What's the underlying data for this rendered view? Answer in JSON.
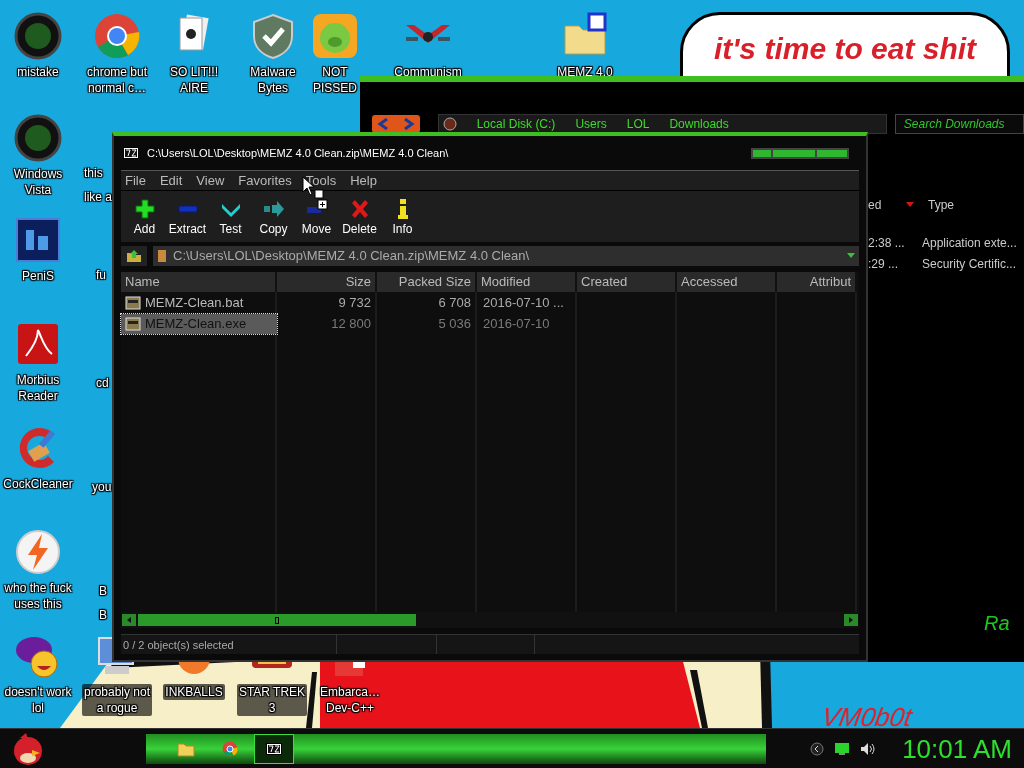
{
  "desktop": {
    "icons": [
      {
        "label": "mistake"
      },
      {
        "label": "chrome but\nnormal c…"
      },
      {
        "label": "SO LIT!!!\nAIRE"
      },
      {
        "label": "Malware\nBytes"
      },
      {
        "label": "NOT\nPISSED"
      },
      {
        "label": "Communism"
      },
      {
        "label": "MEMZ 4.0"
      },
      {
        "label": "Windows\nVista"
      },
      {
        "label": "PeniS"
      },
      {
        "label": "Morbius\nReader"
      },
      {
        "label": "CockCleaner"
      },
      {
        "label": "who the fuck\nuses this"
      },
      {
        "label": "doesn't work\nlol"
      },
      {
        "label": "probably not\na rogue"
      },
      {
        "label": "INKBALLS"
      },
      {
        "label": "STAR TREK\n3"
      },
      {
        "label": "Embarca…\nDev-C++"
      }
    ],
    "partial_labels": [
      {
        "label": "this\nlike a"
      },
      {
        "label": "fu"
      },
      {
        "label": "cd"
      },
      {
        "label": "you"
      },
      {
        "label": "B\nB"
      }
    ]
  },
  "wallpaper": {
    "bubble_text": "it's time to eat shit",
    "signature": "VM0b0t"
  },
  "explorer": {
    "breadcrumbs": [
      "Local Disk (C:)",
      "Users",
      "LOL",
      "Downloads"
    ],
    "search": {
      "placeholder": "Search Downloads"
    },
    "columns": [
      "ed",
      "Type"
    ],
    "rows": [
      [
        "2:38 ...",
        "Application exte..."
      ],
      [
        ":29 ...",
        "Security Certific..."
      ]
    ],
    "corner_text": "Ra"
  },
  "archive_window": {
    "title": "C:\\Users\\LOL\\Desktop\\MEMZ 4.0 Clean.zip\\MEMZ 4.0 Clean\\",
    "menu": [
      "File",
      "Edit",
      "View",
      "Favorites",
      "Tools",
      "Help"
    ],
    "toolbar": [
      "Add",
      "Extract",
      "Test",
      "Copy",
      "Move",
      "Delete",
      "Info"
    ],
    "path": "C:\\Users\\LOL\\Desktop\\MEMZ 4.0 Clean.zip\\MEMZ 4.0 Clean\\",
    "columns": [
      "Name",
      "Size",
      "Packed Size",
      "Modified",
      "Created",
      "Accessed",
      "Attribut"
    ],
    "rows": [
      {
        "cells": [
          "MEMZ-Clean.bat",
          "9 732",
          "6 708",
          "2016-07-10 ..."
        ],
        "selected": false
      },
      {
        "cells": [
          "MEMZ-Clean.exe",
          "12 800",
          "5 036",
          "2016-07-10"
        ],
        "selected": true
      }
    ],
    "status": "0 / 2 object(s) selected"
  },
  "taskbar": {
    "items": [
      {
        "kind": "folder",
        "selected": false
      },
      {
        "kind": "browser",
        "selected": false
      },
      {
        "kind": "archiver",
        "selected": true
      }
    ],
    "clock": "10:01 AM"
  }
}
